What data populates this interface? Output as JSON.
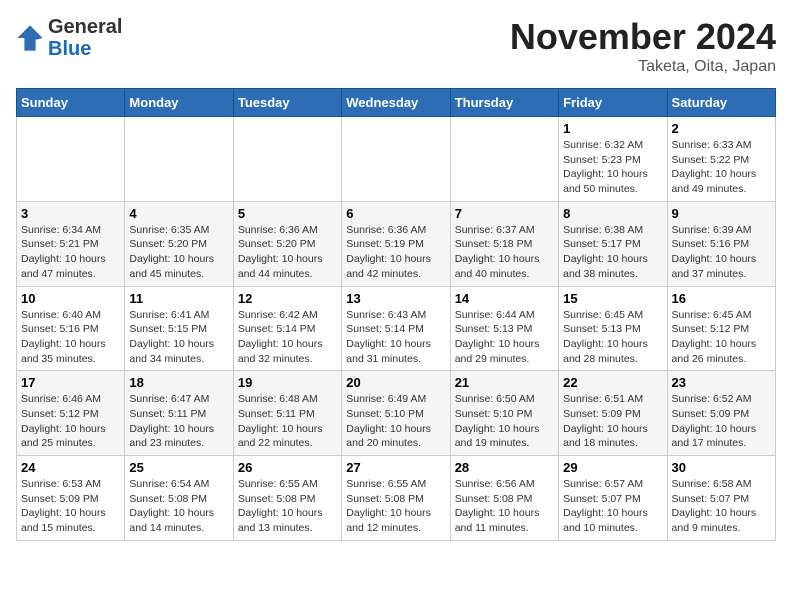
{
  "header": {
    "logo_general": "General",
    "logo_blue": "Blue",
    "month_title": "November 2024",
    "location": "Taketa, Oita, Japan"
  },
  "weekdays": [
    "Sunday",
    "Monday",
    "Tuesday",
    "Wednesday",
    "Thursday",
    "Friday",
    "Saturday"
  ],
  "weeks": [
    [
      {
        "day": "",
        "info": ""
      },
      {
        "day": "",
        "info": ""
      },
      {
        "day": "",
        "info": ""
      },
      {
        "day": "",
        "info": ""
      },
      {
        "day": "",
        "info": ""
      },
      {
        "day": "1",
        "info": "Sunrise: 6:32 AM\nSunset: 5:23 PM\nDaylight: 10 hours\nand 50 minutes."
      },
      {
        "day": "2",
        "info": "Sunrise: 6:33 AM\nSunset: 5:22 PM\nDaylight: 10 hours\nand 49 minutes."
      }
    ],
    [
      {
        "day": "3",
        "info": "Sunrise: 6:34 AM\nSunset: 5:21 PM\nDaylight: 10 hours\nand 47 minutes."
      },
      {
        "day": "4",
        "info": "Sunrise: 6:35 AM\nSunset: 5:20 PM\nDaylight: 10 hours\nand 45 minutes."
      },
      {
        "day": "5",
        "info": "Sunrise: 6:36 AM\nSunset: 5:20 PM\nDaylight: 10 hours\nand 44 minutes."
      },
      {
        "day": "6",
        "info": "Sunrise: 6:36 AM\nSunset: 5:19 PM\nDaylight: 10 hours\nand 42 minutes."
      },
      {
        "day": "7",
        "info": "Sunrise: 6:37 AM\nSunset: 5:18 PM\nDaylight: 10 hours\nand 40 minutes."
      },
      {
        "day": "8",
        "info": "Sunrise: 6:38 AM\nSunset: 5:17 PM\nDaylight: 10 hours\nand 38 minutes."
      },
      {
        "day": "9",
        "info": "Sunrise: 6:39 AM\nSunset: 5:16 PM\nDaylight: 10 hours\nand 37 minutes."
      }
    ],
    [
      {
        "day": "10",
        "info": "Sunrise: 6:40 AM\nSunset: 5:16 PM\nDaylight: 10 hours\nand 35 minutes."
      },
      {
        "day": "11",
        "info": "Sunrise: 6:41 AM\nSunset: 5:15 PM\nDaylight: 10 hours\nand 34 minutes."
      },
      {
        "day": "12",
        "info": "Sunrise: 6:42 AM\nSunset: 5:14 PM\nDaylight: 10 hours\nand 32 minutes."
      },
      {
        "day": "13",
        "info": "Sunrise: 6:43 AM\nSunset: 5:14 PM\nDaylight: 10 hours\nand 31 minutes."
      },
      {
        "day": "14",
        "info": "Sunrise: 6:44 AM\nSunset: 5:13 PM\nDaylight: 10 hours\nand 29 minutes."
      },
      {
        "day": "15",
        "info": "Sunrise: 6:45 AM\nSunset: 5:13 PM\nDaylight: 10 hours\nand 28 minutes."
      },
      {
        "day": "16",
        "info": "Sunrise: 6:45 AM\nSunset: 5:12 PM\nDaylight: 10 hours\nand 26 minutes."
      }
    ],
    [
      {
        "day": "17",
        "info": "Sunrise: 6:46 AM\nSunset: 5:12 PM\nDaylight: 10 hours\nand 25 minutes."
      },
      {
        "day": "18",
        "info": "Sunrise: 6:47 AM\nSunset: 5:11 PM\nDaylight: 10 hours\nand 23 minutes."
      },
      {
        "day": "19",
        "info": "Sunrise: 6:48 AM\nSunset: 5:11 PM\nDaylight: 10 hours\nand 22 minutes."
      },
      {
        "day": "20",
        "info": "Sunrise: 6:49 AM\nSunset: 5:10 PM\nDaylight: 10 hours\nand 20 minutes."
      },
      {
        "day": "21",
        "info": "Sunrise: 6:50 AM\nSunset: 5:10 PM\nDaylight: 10 hours\nand 19 minutes."
      },
      {
        "day": "22",
        "info": "Sunrise: 6:51 AM\nSunset: 5:09 PM\nDaylight: 10 hours\nand 18 minutes."
      },
      {
        "day": "23",
        "info": "Sunrise: 6:52 AM\nSunset: 5:09 PM\nDaylight: 10 hours\nand 17 minutes."
      }
    ],
    [
      {
        "day": "24",
        "info": "Sunrise: 6:53 AM\nSunset: 5:09 PM\nDaylight: 10 hours\nand 15 minutes."
      },
      {
        "day": "25",
        "info": "Sunrise: 6:54 AM\nSunset: 5:08 PM\nDaylight: 10 hours\nand 14 minutes."
      },
      {
        "day": "26",
        "info": "Sunrise: 6:55 AM\nSunset: 5:08 PM\nDaylight: 10 hours\nand 13 minutes."
      },
      {
        "day": "27",
        "info": "Sunrise: 6:55 AM\nSunset: 5:08 PM\nDaylight: 10 hours\nand 12 minutes."
      },
      {
        "day": "28",
        "info": "Sunrise: 6:56 AM\nSunset: 5:08 PM\nDaylight: 10 hours\nand 11 minutes."
      },
      {
        "day": "29",
        "info": "Sunrise: 6:57 AM\nSunset: 5:07 PM\nDaylight: 10 hours\nand 10 minutes."
      },
      {
        "day": "30",
        "info": "Sunrise: 6:58 AM\nSunset: 5:07 PM\nDaylight: 10 hours\nand 9 minutes."
      }
    ]
  ]
}
